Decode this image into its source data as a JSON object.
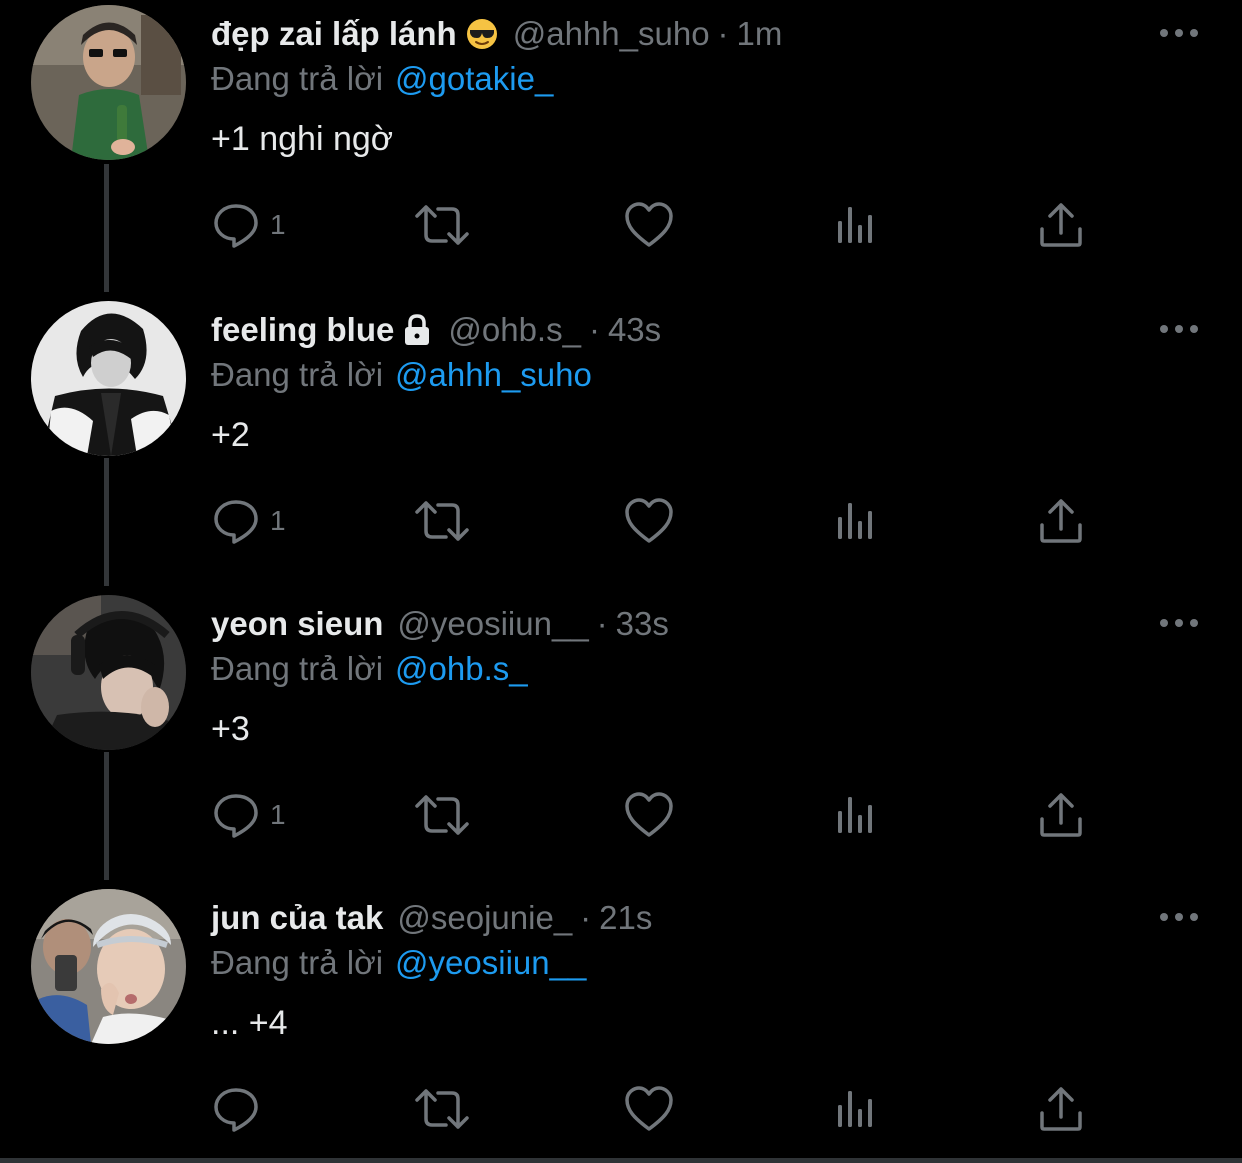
{
  "reply_prefix": "Đang trả lời",
  "colors": {
    "background": "#000000",
    "text_primary": "#e7e9ea",
    "text_secondary": "#71767b",
    "accent": "#1d9bf0",
    "thread_line": "#333639"
  },
  "tweets": [
    {
      "display_name": "đẹp zai lấp lánh",
      "name_badge": "sunglasses-emoji",
      "handle": "@ahhh_suho",
      "separator": "·",
      "time": "1m",
      "reply_to": "@gotakie_",
      "text": "+1 nghi ngờ",
      "reply_count": "1"
    },
    {
      "display_name": "feeling blue",
      "name_badge": "lock-icon",
      "handle": "@ohb.s_",
      "separator": "·",
      "time": "43s",
      "reply_to": "@ahhh_suho",
      "text": "+2",
      "reply_count": "1"
    },
    {
      "display_name": "yeon sieun",
      "name_badge": "",
      "handle": "@yeosiiun__",
      "separator": "·",
      "time": "33s",
      "reply_to": "@ohb.s_",
      "text": "+3",
      "reply_count": "1"
    },
    {
      "display_name": "jun của tak",
      "name_badge": "",
      "handle": "@seojunie_",
      "separator": "·",
      "time": "21s",
      "reply_to": "@yeosiiun__",
      "text": "... +4",
      "reply_count": ""
    }
  ]
}
